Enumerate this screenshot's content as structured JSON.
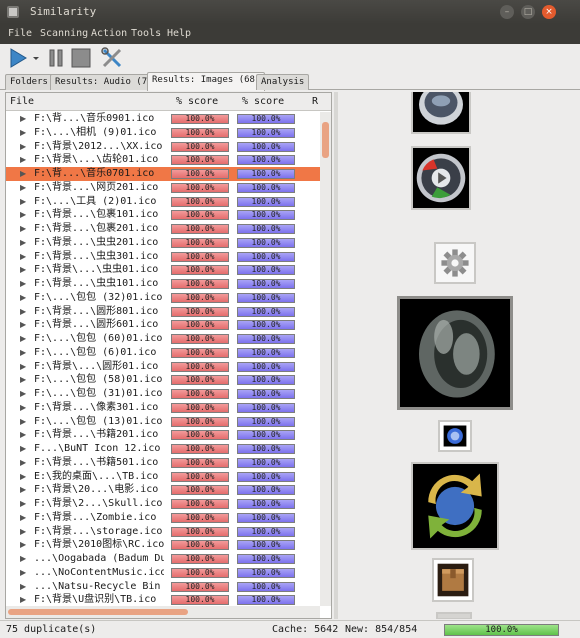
{
  "window": {
    "title": "Similarity",
    "controls": [
      "minimize",
      "maximize",
      "close"
    ],
    "close_color": "#e35b2e"
  },
  "menu": [
    "File",
    "Scanning",
    "Action",
    "Tools",
    "Help"
  ],
  "toolbar": {
    "icons": [
      "play-icon",
      "dropdown-arrow-icon",
      "pause-icon",
      "stop-icon",
      "tools-icon"
    ]
  },
  "tabs": [
    {
      "label": "Folders",
      "active": false
    },
    {
      "label": "Results: Audio (7)",
      "active": false
    },
    {
      "label": "Results: Images (68)",
      "active": true
    },
    {
      "label": "Analysis",
      "active": false
    }
  ],
  "columns": {
    "file": "File",
    "score1": "% score",
    "score2": "% score",
    "extra": "R"
  },
  "rows": [
    {
      "file": "F:\\背...\\音乐0901.ico",
      "score1": "100.0%",
      "score2": "100.0%"
    },
    {
      "file": "F:\\...\\相机 (9)01.ico",
      "score1": "100.0%",
      "score2": "100.0%"
    },
    {
      "file": "F:\\背景\\2012...\\XX.ico",
      "score1": "100.0%",
      "score2": "100.0%"
    },
    {
      "file": "F:\\背景\\...\\齿轮01.ico",
      "score1": "100.0%",
      "score2": "100.0%"
    },
    {
      "file": "F:\\背...\\音乐0701.ico",
      "score1": "100.0%",
      "score2": "100.0%",
      "selected": true
    },
    {
      "file": "F:\\背景...\\网页201.ico",
      "score1": "100.0%",
      "score2": "100.0%"
    },
    {
      "file": "F:\\...\\工具 (2)01.ico",
      "score1": "100.0%",
      "score2": "100.0%"
    },
    {
      "file": "F:\\背景...\\包裹101.ico",
      "score1": "100.0%",
      "score2": "100.0%"
    },
    {
      "file": "F:\\背景...\\包裹201.ico",
      "score1": "100.0%",
      "score2": "100.0%"
    },
    {
      "file": "F:\\背景...\\虫虫201.ico",
      "score1": "100.0%",
      "score2": "100.0%"
    },
    {
      "file": "F:\\背景...\\虫虫301.ico",
      "score1": "100.0%",
      "score2": "100.0%"
    },
    {
      "file": "F:\\背景\\...\\虫虫01.ico",
      "score1": "100.0%",
      "score2": "100.0%"
    },
    {
      "file": "F:\\背景...\\虫虫101.ico",
      "score1": "100.0%",
      "score2": "100.0%"
    },
    {
      "file": "F:\\...\\包包 (32)01.ico",
      "score1": "100.0%",
      "score2": "100.0%"
    },
    {
      "file": "F:\\背景...\\圆形801.ico",
      "score1": "100.0%",
      "score2": "100.0%"
    },
    {
      "file": "F:\\背景...\\圆形601.ico",
      "score1": "100.0%",
      "score2": "100.0%"
    },
    {
      "file": "F:\\...\\包包 (60)01.ico",
      "score1": "100.0%",
      "score2": "100.0%"
    },
    {
      "file": "F:\\...\\包包 (6)01.ico",
      "score1": "100.0%",
      "score2": "100.0%"
    },
    {
      "file": "F:\\背景\\...\\圆形01.ico",
      "score1": "100.0%",
      "score2": "100.0%"
    },
    {
      "file": "F:\\...\\包包 (58)01.ico",
      "score1": "100.0%",
      "score2": "100.0%"
    },
    {
      "file": "F:\\...\\包包 (31)01.ico",
      "score1": "100.0%",
      "score2": "100.0%"
    },
    {
      "file": "F:\\背景...\\像素301.ico",
      "score1": "100.0%",
      "score2": "100.0%"
    },
    {
      "file": "F:\\...\\包包 (13)01.ico",
      "score1": "100.0%",
      "score2": "100.0%"
    },
    {
      "file": "F:\\背景...\\书籍201.ico",
      "score1": "100.0%",
      "score2": "100.0%"
    },
    {
      "file": "F...\\BuNT Icon 12.ico",
      "score1": "100.0%",
      "score2": "100.0%"
    },
    {
      "file": "F:\\背景...\\书籍501.ico",
      "score1": "100.0%",
      "score2": "100.0%"
    },
    {
      "file": "E:\\我的桌面\\...\\TB.ico",
      "score1": "100.0%",
      "score2": "100.0%"
    },
    {
      "file": "F:\\背景\\20...\\电影.ico",
      "score1": "100.0%",
      "score2": "100.0%"
    },
    {
      "file": "F:\\背景\\2...\\Skull.ico",
      "score1": "100.0%",
      "score2": "100.0%"
    },
    {
      "file": "F:\\背景...\\Zombie.ico",
      "score1": "100.0%",
      "score2": "100.0%"
    },
    {
      "file": "F:\\背景...\\storage.ico",
      "score1": "100.0%",
      "score2": "100.0%"
    },
    {
      "file": "F:\\背景\\2010图标\\RC.ico",
      "score1": "100.0%",
      "score2": "100.0%"
    },
    {
      "file": "...\\Oogabada (Badum Du",
      "score1": "100.0%",
      "score2": "100.0%"
    },
    {
      "file": "...\\NoContentMusic.ico",
      "score1": "100.0%",
      "score2": "100.0%"
    },
    {
      "file": "...\\Natsu-Recycle Bin",
      "score1": "100.0%",
      "score2": "100.0%"
    },
    {
      "file": "F:\\背景\\U盘识别\\TB.ico",
      "score1": "100.0%",
      "score2": "100.0%"
    }
  ],
  "thumbnails": [
    {
      "name": "music-orb-thumbnail"
    },
    {
      "name": "media-play-orb-thumbnail"
    },
    {
      "name": "gear-thumbnail"
    },
    {
      "name": "speaker-thumbnail"
    },
    {
      "name": "blue-orb-thumbnail"
    },
    {
      "name": "recycle-arrows-thumbnail"
    },
    {
      "name": "package-box-thumbnail"
    }
  ],
  "status": {
    "duplicates": "75 duplicate(s)",
    "cache": "Cache: 5642",
    "new": "New: 854/854",
    "progress_label": "100.0%",
    "progress": 1.0,
    "progress_color": "#5fc24a"
  },
  "colors": {
    "selection": "#f07746",
    "score_red": "#e56d6d",
    "score_blue": "#7d72ee",
    "title_bg": "#3c3b37"
  }
}
